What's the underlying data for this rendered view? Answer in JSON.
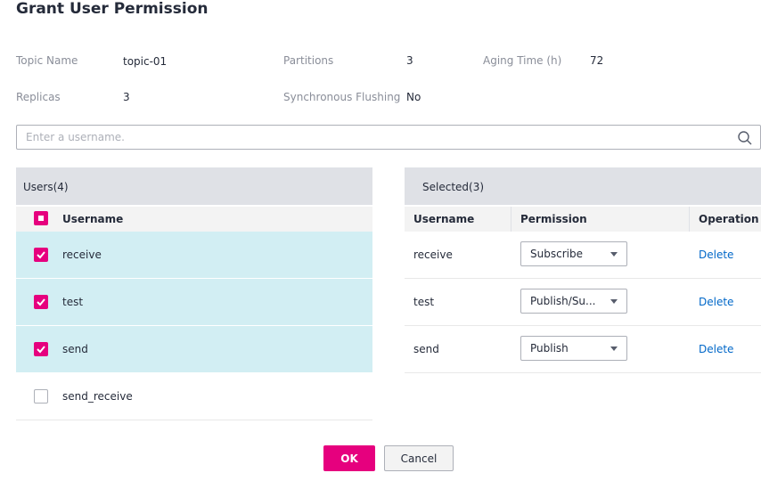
{
  "dialog": {
    "title": "Grant User Permission"
  },
  "info": {
    "topic_name_label": "Topic Name",
    "topic_name_value": "topic-01",
    "partitions_label": "Partitions",
    "partitions_value": "3",
    "aging_label": "Aging Time (h)",
    "aging_value": "72",
    "replicas_label": "Replicas",
    "replicas_value": "3",
    "sync_label": "Synchronous Flushing",
    "sync_value": "No"
  },
  "search": {
    "placeholder": "Enter a username.",
    "icon": "search-icon"
  },
  "users_panel": {
    "header": "Users(4)",
    "column_username": "Username",
    "rows": [
      {
        "username": "receive",
        "checked": true
      },
      {
        "username": "test",
        "checked": true
      },
      {
        "username": "send",
        "checked": true
      },
      {
        "username": "send_receive",
        "checked": false
      }
    ]
  },
  "selected_panel": {
    "header": "Selected(3)",
    "column_username": "Username",
    "column_permission": "Permission",
    "column_operation": "Operation",
    "rows": [
      {
        "username": "receive",
        "permission": "Subscribe",
        "operation": "Delete"
      },
      {
        "username": "test",
        "permission": "Publish/Su...",
        "operation": "Delete"
      },
      {
        "username": "send",
        "permission": "Publish",
        "operation": "Delete"
      }
    ]
  },
  "footer": {
    "ok_label": "OK",
    "cancel_label": "Cancel"
  },
  "colors": {
    "accent": "#e6007e",
    "selected_row": "#d2eef3",
    "link": "#0067c8"
  }
}
